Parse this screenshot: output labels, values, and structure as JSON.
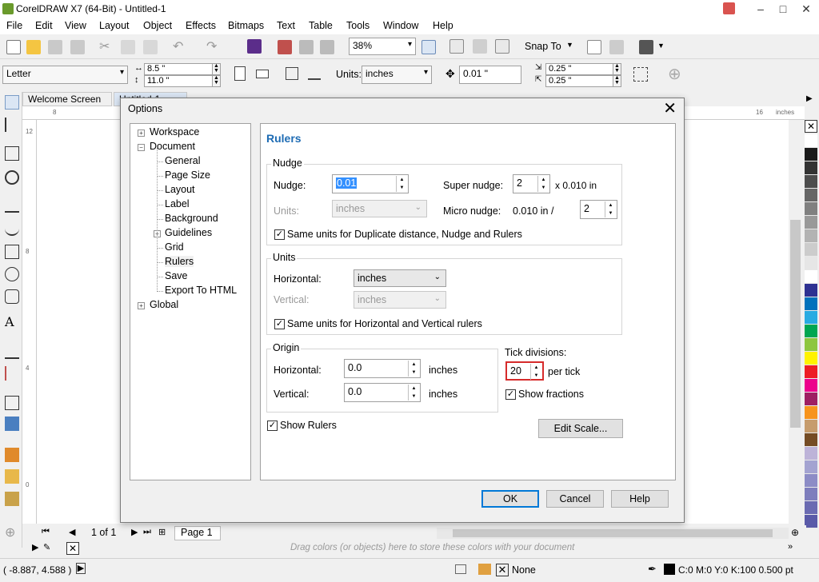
{
  "app": {
    "title": "CorelDRAW X7 (64-Bit) - Untitled-1",
    "window_controls": [
      "–",
      "□",
      "✕"
    ]
  },
  "menu": [
    "File",
    "Edit",
    "View",
    "Layout",
    "Object",
    "Effects",
    "Bitmaps",
    "Text",
    "Table",
    "Tools",
    "Window",
    "Help"
  ],
  "toolbar": {
    "zoom": "38%",
    "snap_to": "Snap To"
  },
  "propbar": {
    "page_size": "Letter",
    "width": "8.5 \"",
    "height": "11.0 \"",
    "units_label": "Units:",
    "units": "inches",
    "nudge": "0.01 \"",
    "dup_x": "0.25 \"",
    "dup_y": "0.25 \""
  },
  "tabs": {
    "welcome": "Welcome Screen",
    "doc": "Untitled-1"
  },
  "ruler": {
    "h_left": "8",
    "h_right": "16",
    "unit": "inches",
    "v_marks": [
      "12",
      "8",
      "4",
      "0"
    ]
  },
  "dialog": {
    "title": "Options",
    "tree": [
      {
        "label": "Workspace",
        "level": 0,
        "expander": "+"
      },
      {
        "label": "Document",
        "level": 0,
        "expander": "−"
      },
      {
        "label": "General",
        "level": 1
      },
      {
        "label": "Page Size",
        "level": 1
      },
      {
        "label": "Layout",
        "level": 1
      },
      {
        "label": "Label",
        "level": 1
      },
      {
        "label": "Background",
        "level": 1
      },
      {
        "label": "Guidelines",
        "level": 1,
        "expander": "+"
      },
      {
        "label": "Grid",
        "level": 1
      },
      {
        "label": "Rulers",
        "level": 1,
        "selected": true
      },
      {
        "label": "Save",
        "level": 1
      },
      {
        "label": "Export To HTML",
        "level": 1
      },
      {
        "label": "Global",
        "level": 0,
        "expander": "+"
      }
    ],
    "panel_title": "Rulers",
    "nudge_group": {
      "label": "Nudge",
      "nudge_label": "Nudge:",
      "nudge_value": "0.01",
      "units_label": "Units:",
      "units_value": "inches",
      "super_nudge_label": "Super nudge:",
      "super_nudge_value": "2",
      "super_nudge_suffix": "x 0.010 in",
      "micro_nudge_label": "Micro nudge:",
      "micro_nudge_prefix": "0.010 in /",
      "micro_nudge_value": "2",
      "same_units_label": "Same units for Duplicate distance, Nudge and Rulers"
    },
    "units_group": {
      "label": "Units",
      "horizontal_label": "Horizontal:",
      "horizontal_value": "inches",
      "vertical_label": "Vertical:",
      "vertical_value": "inches",
      "same_units_label": "Same units for Horizontal and Vertical rulers"
    },
    "origin_group": {
      "label": "Origin",
      "horizontal_label": "Horizontal:",
      "horizontal_value": "0.0",
      "horizontal_unit": "inches",
      "vertical_label": "Vertical:",
      "vertical_value": "0.0",
      "vertical_unit": "inches"
    },
    "tick": {
      "label": "Tick divisions:",
      "value": "20",
      "suffix": "per tick",
      "show_fractions": "Show fractions"
    },
    "show_rulers": "Show Rulers",
    "edit_scale": "Edit Scale...",
    "ok": "OK",
    "cancel": "Cancel",
    "help": "Help"
  },
  "docbar": {
    "page_count": "1 of 1",
    "page_tab": "Page 1"
  },
  "colorbar_hint": "Drag colors (or objects) here to store these colors with your document",
  "status": {
    "coords": "( -8.887, 4.588 )",
    "fill": "None",
    "outline": "C:0 M:0 Y:0 K:100  0.500 pt"
  },
  "palette": [
    "#ffffff",
    "#1a1a1a",
    "#333333",
    "#4d4d4d",
    "#666666",
    "#808080",
    "#999999",
    "#b3b3b3",
    "#cccccc",
    "#e6e6e6",
    "#ffffff",
    "#2e3192",
    "#0071bc",
    "#29abe2",
    "#00a651",
    "#8dc63f",
    "#fff200",
    "#ed1c24",
    "#ec008c",
    "#9e1f63",
    "#f7941d",
    "#c69c6d",
    "#754c24",
    "#bdb3d8",
    "#a3a3d1",
    "#8c8cc6",
    "#7e7ebd",
    "#6b6bb2",
    "#5a5aa8"
  ]
}
